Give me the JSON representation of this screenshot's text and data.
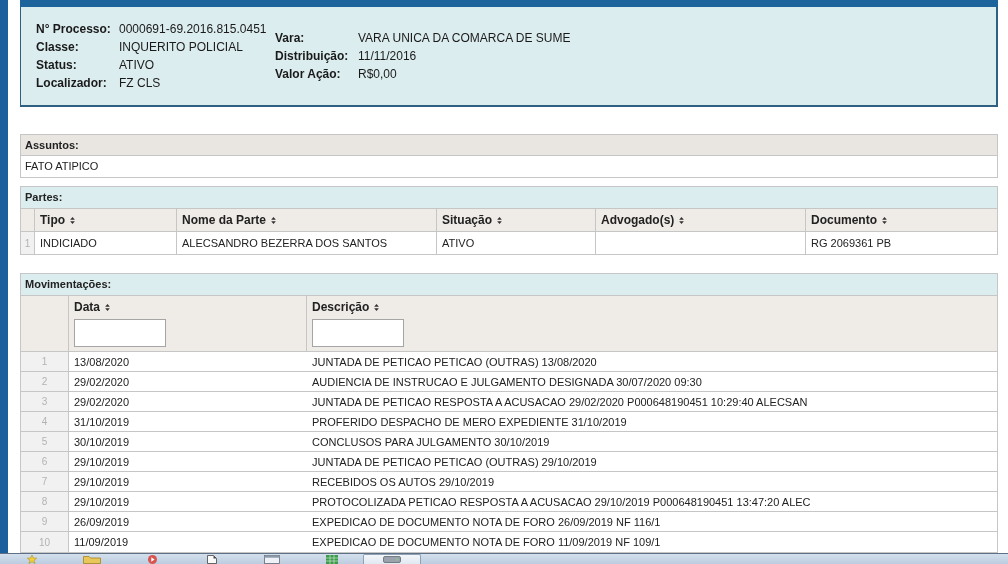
{
  "processo": {
    "left": [
      {
        "label": "N° Processo:",
        "value": "0000691-69.2016.815.0451"
      },
      {
        "label": "Classe:",
        "value": "INQUERITO POLICIAL"
      },
      {
        "label": "Status:",
        "value": "ATIVO"
      },
      {
        "label": "Localizador:",
        "value": "FZ CLS"
      }
    ],
    "right": [
      {
        "label": "Vara:",
        "value": "VARA UNICA DA COMARCA DE SUME"
      },
      {
        "label": "Distribuição:",
        "value": "11/11/2016"
      },
      {
        "label": "Valor Ação:",
        "value": "R$0,00"
      }
    ]
  },
  "assuntos": {
    "title": "Assuntos:",
    "items": [
      "FATO ATIPICO"
    ]
  },
  "partes": {
    "title": "Partes:",
    "columns": [
      {
        "label": "Tipo",
        "sortable": true
      },
      {
        "label": "Nome da Parte",
        "sortable": true
      },
      {
        "label": "Situação",
        "sortable": true
      },
      {
        "label": "Advogado(s)",
        "sortable": true
      },
      {
        "label": "Documento",
        "sortable": true
      }
    ],
    "rows": [
      {
        "number": "1",
        "cells": [
          "INDICIADO",
          "ALECSANDRO BEZERRA DOS SANTOS",
          "ATIVO",
          null,
          "RG 2069361 PB"
        ]
      }
    ]
  },
  "movimentacoes": {
    "title": "Movimentações:",
    "columns": [
      {
        "label": "Data",
        "sortable": true,
        "filter": true
      },
      {
        "label": "Descrição",
        "sortable": true,
        "filter": true
      }
    ],
    "rows": [
      {
        "number": "1",
        "cells": [
          "13/08/2020",
          "JUNTADA DE PETICAO PETICAO (OUTRAS) 13/08/2020"
        ]
      },
      {
        "number": "2",
        "cells": [
          "29/02/2020",
          "AUDIENCIA DE INSTRUCAO E JULGAMENTO DESIGNADA 30/07/2020 09:30"
        ]
      },
      {
        "number": "3",
        "cells": [
          "29/02/2020",
          "JUNTADA DE PETICAO RESPOSTA A ACUSACAO 29/02/2020 P000648190451 10:29:40 ALECSAN"
        ]
      },
      {
        "number": "4",
        "cells": [
          "31/10/2019",
          "PROFERIDO DESPACHO DE MERO EXPEDIENTE 31/10/2019"
        ]
      },
      {
        "number": "5",
        "cells": [
          "30/10/2019",
          "CONCLUSOS PARA JULGAMENTO 30/10/2019"
        ]
      },
      {
        "number": "6",
        "cells": [
          "29/10/2019",
          "JUNTADA DE PETICAO PETICAO (OUTRAS) 29/10/2019"
        ]
      },
      {
        "number": "7",
        "cells": [
          "29/10/2019",
          "RECEBIDOS OS AUTOS 29/10/2019"
        ]
      },
      {
        "number": "8",
        "cells": [
          "29/10/2019",
          "PROTOCOLIZADA PETICAO RESPOSTA A ACUSACAO 29/10/2019 P000648190451 13:47:20 ALEC"
        ]
      },
      {
        "number": "9",
        "cells": [
          "26/09/2019",
          "EXPEDICAO DE DOCUMENTO NOTA DE FORO 26/09/2019 NF 116/1"
        ]
      },
      {
        "number": "10",
        "cells": [
          "11/09/2019",
          "EXPEDICAO DE DOCUMENTO NOTA DE FORO 11/09/2019 NF 109/1"
        ]
      }
    ]
  },
  "taskbar": {
    "apps": [
      {
        "kind": "star",
        "selected": false
      },
      {
        "kind": "folder",
        "selected": false
      },
      {
        "kind": "play",
        "selected": false
      },
      {
        "kind": "document",
        "selected": false
      },
      {
        "kind": "window",
        "selected": false
      },
      {
        "kind": "spreadsheet",
        "selected": false
      },
      {
        "kind": "drive",
        "selected": true
      }
    ]
  }
}
